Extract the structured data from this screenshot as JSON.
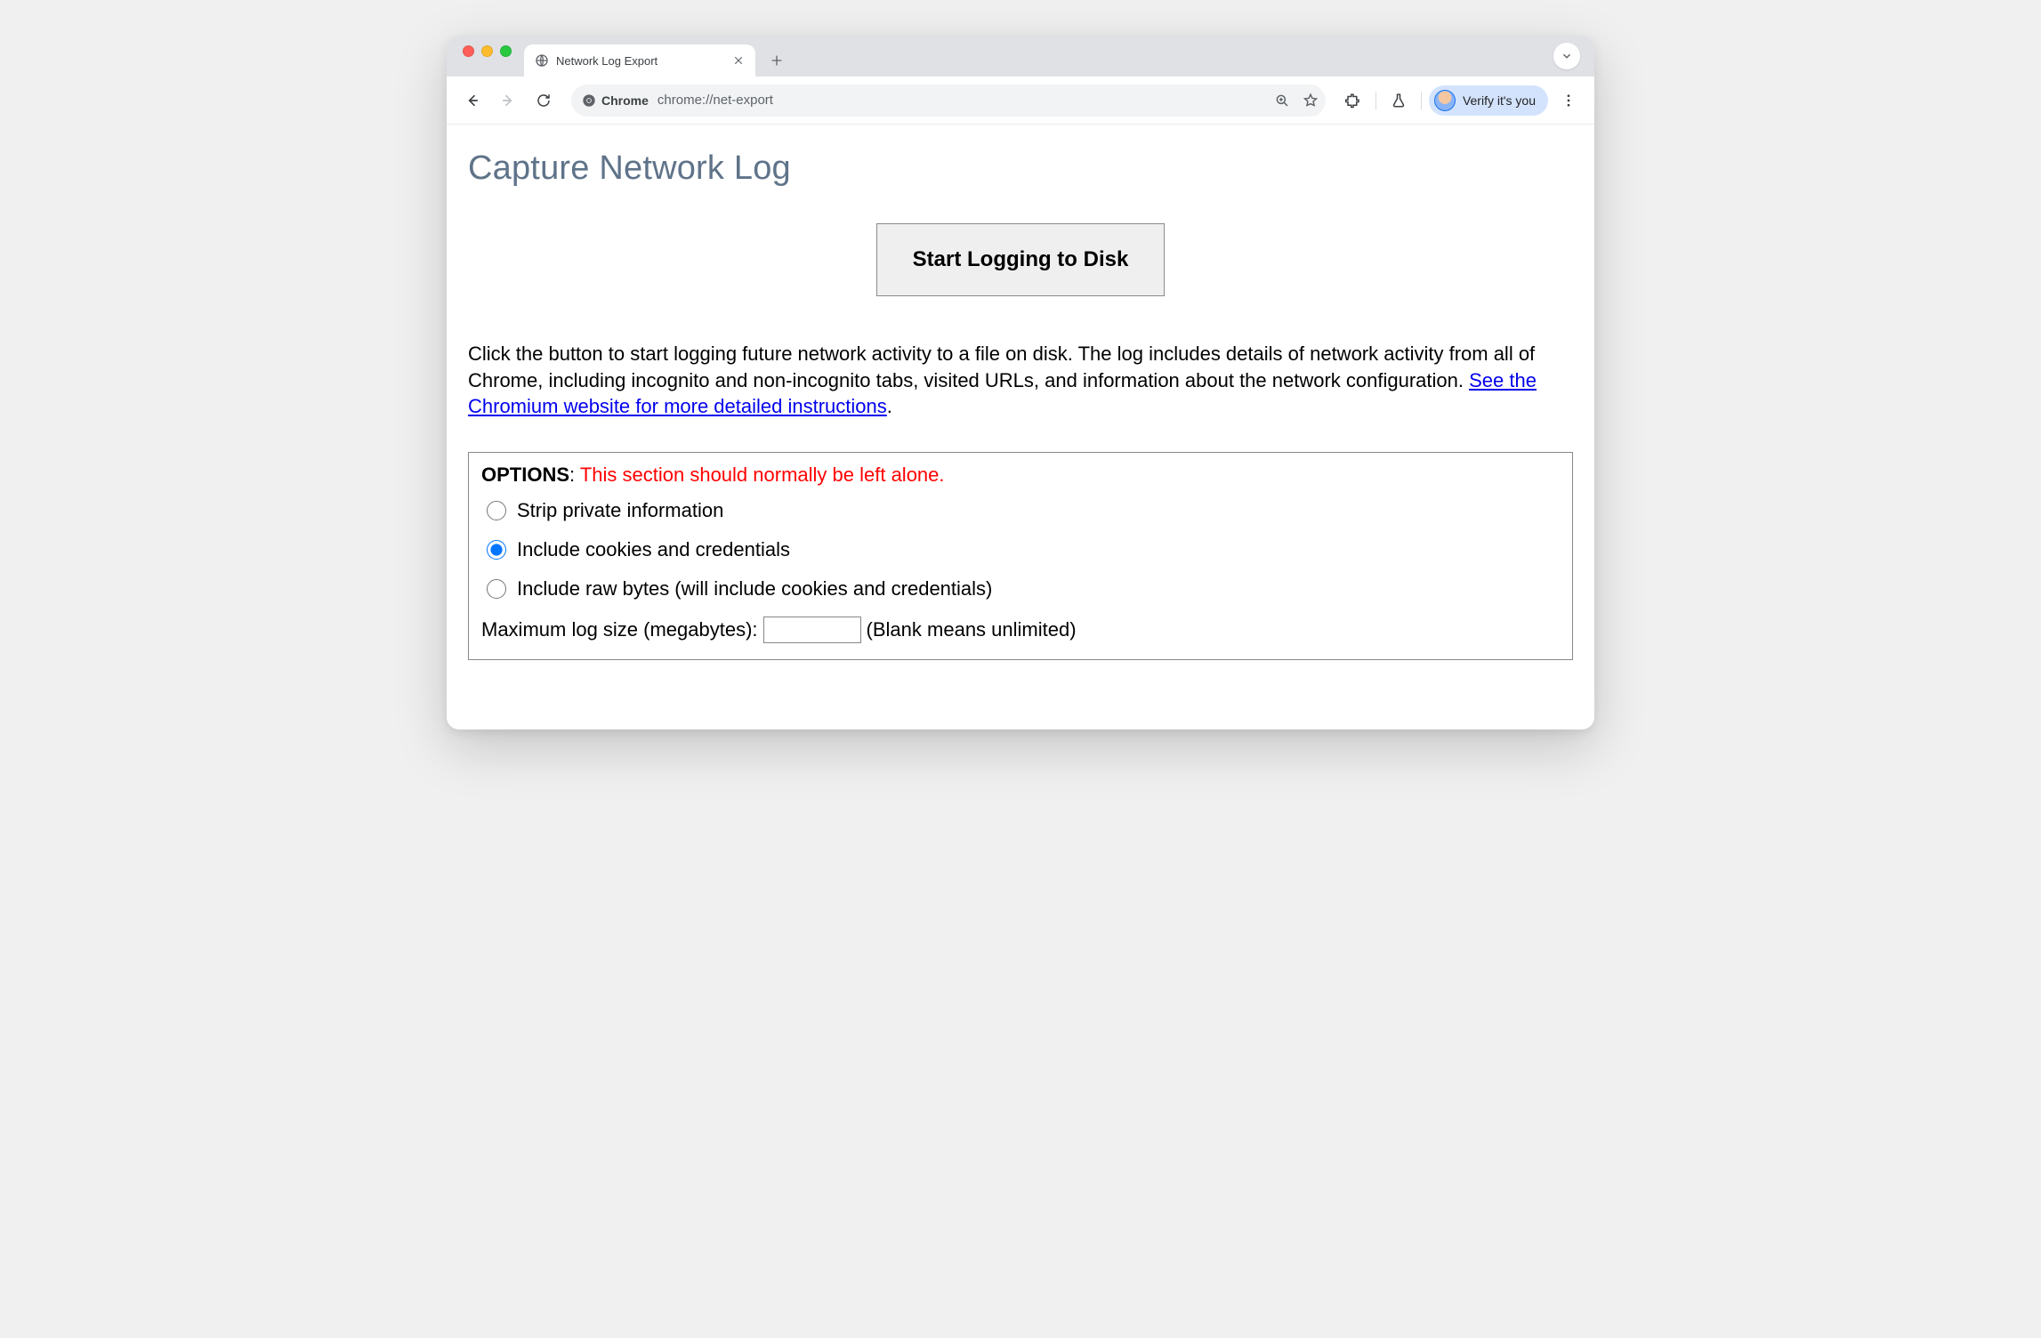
{
  "tab": {
    "title": "Network Log Export"
  },
  "toolbar": {
    "chrome_label": "Chrome",
    "url": "chrome://net-export",
    "verify_label": "Verify it's you"
  },
  "page": {
    "heading": "Capture Network Log",
    "start_button": "Start Logging to Disk",
    "description_pre": "Click the button to start logging future network activity to a file on disk. The log includes details of network activity from all of Chrome, including incognito and non-incognito tabs, visited URLs, and information about the network configuration. ",
    "description_link": "See the Chromium website for more detailed instructions",
    "description_post": "."
  },
  "options": {
    "label": "OPTIONS",
    "colon_space": ": ",
    "warning": "This section should normally be left alone.",
    "radios": [
      {
        "label": "Strip private information",
        "checked": false
      },
      {
        "label": "Include cookies and credentials",
        "checked": true
      },
      {
        "label": "Include raw bytes (will include cookies and credentials)",
        "checked": false
      }
    ],
    "max_size_label": "Maximum log size (megabytes): ",
    "max_size_value": "",
    "max_size_hint": "(Blank means unlimited)"
  }
}
